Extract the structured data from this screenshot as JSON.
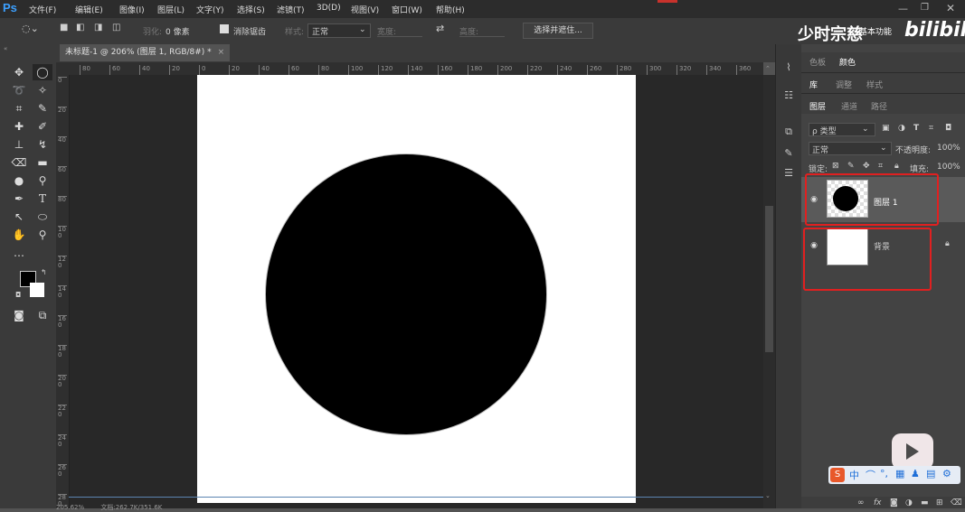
{
  "app": {
    "logo": "Ps"
  },
  "menu": [
    "文件(F)",
    "编辑(E)",
    "图像(I)",
    "图层(L)",
    "文字(Y)",
    "选择(S)",
    "滤镜(T)",
    "3D(D)",
    "视图(V)",
    "窗口(W)",
    "帮助(H)"
  ],
  "window_controls": {
    "minimize": "—",
    "restore": "❐",
    "close": "✕"
  },
  "options": {
    "feather_label": "羽化:",
    "feather_value": "0 像素",
    "antialias_label": "消除锯齿",
    "antialias_checked": true,
    "style_label": "样式:",
    "style_value": "正常",
    "width_label": "宽度:",
    "height_label": "高度:",
    "select_mask": "选择并遮住..."
  },
  "watermark": {
    "text": "少时宗慈",
    "sub": "基本功能",
    "logo": "bilibili"
  },
  "document": {
    "tab_title": "未标题-1 @ 206% (图层 1, RGB/8#) *",
    "close": "×"
  },
  "ruler": {
    "h_ticks": [
      "80",
      "60",
      "40",
      "20",
      "0",
      "20",
      "40",
      "60",
      "80",
      "100",
      "120",
      "140",
      "160",
      "180",
      "200",
      "220",
      "240",
      "260",
      "280",
      "300",
      "320",
      "340",
      "360",
      "38"
    ],
    "v_ticks": [
      "0",
      "2\n0",
      "4\n0",
      "6\n0",
      "8\n0",
      "1\n0\n0",
      "1\n2\n0",
      "1\n4\n0",
      "1\n6\n0",
      "1\n8\n0",
      "2\n0\n0",
      "2\n2\n0",
      "2\n4\n0",
      "2\n6\n0",
      "2\n8\n0"
    ]
  },
  "status": {
    "zoom": "205.62%",
    "doc_info": "文档:262.7K/351.6K"
  },
  "panels": {
    "color_tabs": [
      "色板",
      "颜色"
    ],
    "library_tabs": [
      "库",
      "调整",
      "样式"
    ],
    "layer_tabs": [
      "图层",
      "通道",
      "路径"
    ],
    "filter_label": "ρ 类型",
    "blend_mode": "正常",
    "opacity_label": "不透明度:",
    "opacity_value": "100%",
    "lock_label": "锁定:",
    "fill_label": "填充:",
    "fill_value": "100%",
    "layers": [
      {
        "name": "图层 1",
        "visible": true,
        "selected": true
      },
      {
        "name": "背景",
        "visible": true,
        "locked": true
      }
    ]
  },
  "ime": {
    "items": [
      "中",
      "⌒",
      "°,",
      "▦",
      "♟",
      "▤",
      "⚙"
    ]
  },
  "colors": {
    "accent": "#3ca0ff",
    "highlight": "#e02020",
    "panel": "#434343",
    "canvas_bg": "#282828"
  }
}
